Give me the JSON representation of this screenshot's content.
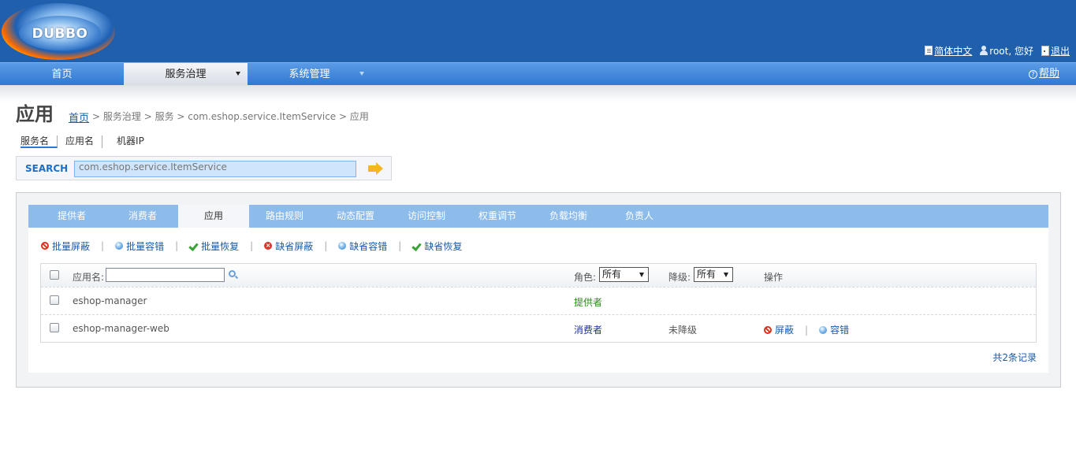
{
  "header": {
    "logo_text": "DUBBO",
    "lang_label": "简体中文",
    "user_greeting": "root, 您好",
    "logout_label": "退出"
  },
  "nav": {
    "items": [
      {
        "label": "首页"
      },
      {
        "label": "服务治理"
      },
      {
        "label": "系统管理"
      }
    ],
    "help_label": "帮助"
  },
  "page": {
    "title": "应用",
    "breadcrumb": {
      "home": "首页",
      "rest": "> 服务治理 > 服务 > com.eshop.service.ItemService > 应用"
    }
  },
  "search": {
    "tabs": [
      "服务名",
      "应用名",
      "机器IP"
    ],
    "label": "SEARCH",
    "value": "com.eshop.service.ItemService"
  },
  "tabs": [
    "提供者",
    "消费者",
    "应用",
    "路由规则",
    "动态配置",
    "访问控制",
    "权重调节",
    "负载均衡",
    "负责人"
  ],
  "actions": {
    "batch_disable": "批量屏蔽",
    "batch_tolerate": "批量容错",
    "batch_recover": "批量恢复",
    "default_disable": "缺省屏蔽",
    "default_tolerate": "缺省容错",
    "default_recover": "缺省恢复"
  },
  "table": {
    "app_name_label": "应用名:",
    "role_label": "角色:",
    "role_selected": "所有",
    "degrade_label": "降级:",
    "degrade_selected": "所有",
    "op_label": "操作",
    "rows": [
      {
        "name": "eshop-manager",
        "role": "提供者",
        "degrade": "",
        "ops": []
      },
      {
        "name": "eshop-manager-web",
        "role": "消费者",
        "degrade": "未降级",
        "ops": [
          "屏蔽",
          "容错"
        ]
      }
    ],
    "total": "共2条记录"
  },
  "colors": {
    "header_bg": "#1f5fac",
    "tabbar_bg": "#8dbbea",
    "link": "#1a5aa6",
    "provider": "#2b8a1a",
    "consumer": "#1c2f9c"
  }
}
